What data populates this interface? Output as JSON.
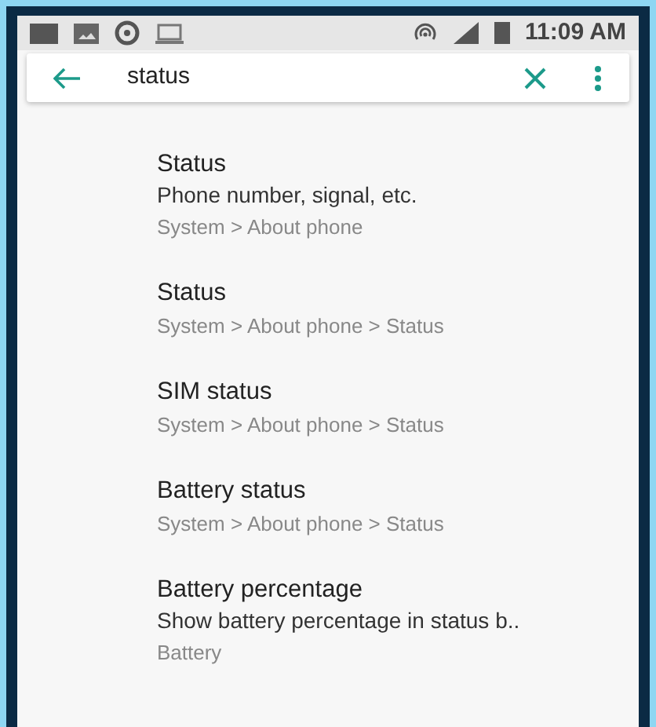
{
  "status_bar": {
    "time": "11:09 AM"
  },
  "search": {
    "value": "status"
  },
  "results": [
    {
      "title": "Status",
      "summary": "Phone number, signal, etc.",
      "path": "System > About phone"
    },
    {
      "title": "Status",
      "path": "System > About phone > Status"
    },
    {
      "title": "SIM status",
      "path": "System > About phone > Status"
    },
    {
      "title": "Battery status",
      "path": "System > About phone > Status"
    },
    {
      "title": "Battery percentage",
      "summary": "Show battery percentage in status b..",
      "path": "Battery"
    }
  ]
}
